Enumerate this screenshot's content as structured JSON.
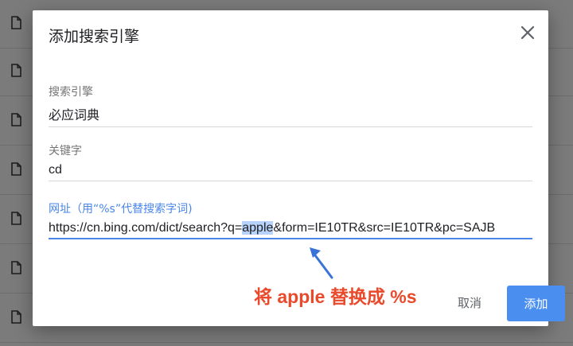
{
  "dialog": {
    "title": "添加搜索引擎",
    "close_icon": "close-icon",
    "fields": {
      "engine": {
        "label": "搜索引擎",
        "value": "必应词典"
      },
      "keyword": {
        "label": "关键字",
        "value": "cd"
      },
      "url": {
        "label": "网址（用“%s”代替搜索字词)",
        "value_before": "https://cn.bing.com/dict/search?q=",
        "value_selected": "apple",
        "value_after": "&form=IE10TR&src=IE10TR&pc=SAJB"
      }
    },
    "cancel_label": "取消",
    "add_label": "添加"
  },
  "annotation": {
    "text": "将 apple 替换成 %s",
    "arrow_icon": "arrow-up-left-icon"
  },
  "colors": {
    "accent": "#4a8ef0",
    "annotation": "#ea4a2c",
    "selection": "#b7d2fb"
  },
  "background_rows": [
    {
      "icon": "file-icon"
    },
    {
      "icon": "file-icon"
    },
    {
      "icon": "file-icon"
    },
    {
      "icon": "file-icon"
    },
    {
      "icon": "file-icon"
    },
    {
      "icon": "file-icon"
    },
    {
      "icon": "file-icon"
    }
  ]
}
